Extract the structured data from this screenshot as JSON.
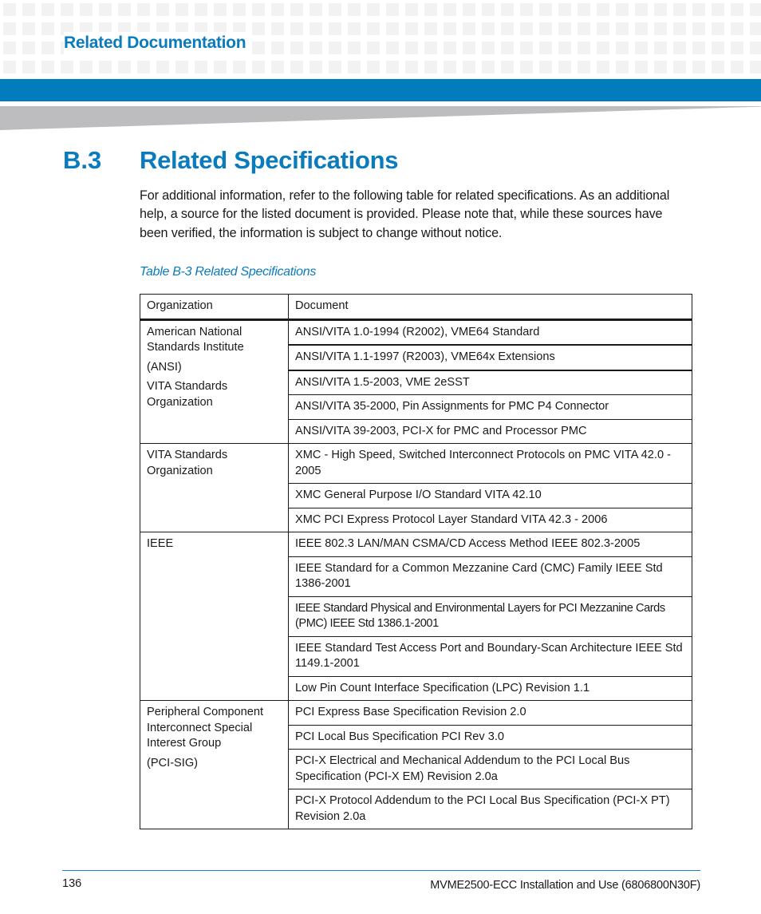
{
  "header": {
    "running_head": "Related Documentation",
    "accent_color": "#037cbd"
  },
  "section": {
    "number": "B.3",
    "title": "Related Specifications",
    "intro": "For additional information, refer to the following table for related specifications. As an additional help, a source for the listed document is provided. Please note that, while these sources have been verified, the information is subject to change without notice."
  },
  "table": {
    "caption": "Table B-3 Related Specifications",
    "columns": [
      "Organization",
      "Document"
    ],
    "groups": [
      {
        "organization": [
          "American National Standards Institute",
          "(ANSI)",
          "VITA Standards Organization"
        ],
        "documents": [
          "ANSI/VITA 1.0-1994 (R2002), VME64 Standard",
          "ANSI/VITA 1.1-1997 (R2003), VME64x Extensions",
          "ANSI/VITA 1.5-2003, VME 2eSST",
          "ANSI/VITA 35-2000, Pin Assignments for PMC P4 Connector",
          "ANSI/VITA 39-2003, PCI-X for PMC and Processor PMC"
        ]
      },
      {
        "organization": [
          "VITA Standards Organization"
        ],
        "documents": [
          "XMC - High Speed, Switched Interconnect Protocols on PMC VITA 42.0 - 2005",
          "XMC General Purpose I/O Standard VITA 42.10",
          "XMC PCI Express Protocol Layer Standard VITA 42.3 - 2006"
        ]
      },
      {
        "organization": [
          "IEEE"
        ],
        "documents": [
          "IEEE 802.3 LAN/MAN CSMA/CD Access Method IEEE 802.3-2005",
          "IEEE Standard for a Common Mezzanine Card (CMC) Family IEEE Std 1386-2001",
          "IEEE Standard Physical and Environmental Layers for PCI Mezzanine Cards (PMC) IEEE Std 1386.1-2001",
          "IEEE Standard Test Access Port and Boundary-Scan Architecture IEEE Std 1149.1-2001",
          "Low Pin Count Interface Specification (LPC) Revision 1.1"
        ]
      },
      {
        "organization": [
          "Peripheral Component Interconnect Special Interest Group",
          "(PCI-SIG)"
        ],
        "documents": [
          "PCI Express Base Specification Revision 2.0",
          "PCI Local Bus Specification PCI Rev 3.0",
          "PCI-X Electrical and Mechanical Addendum to the PCI Local Bus Specification (PCI-X EM) Revision 2.0a",
          "PCI-X Protocol Addendum to the PCI Local Bus Specification (PCI-X PT) Revision 2.0a"
        ]
      }
    ]
  },
  "footer": {
    "page_number": "136",
    "document_id": "MVME2500-ECC Installation and Use (6806800N30F)"
  }
}
